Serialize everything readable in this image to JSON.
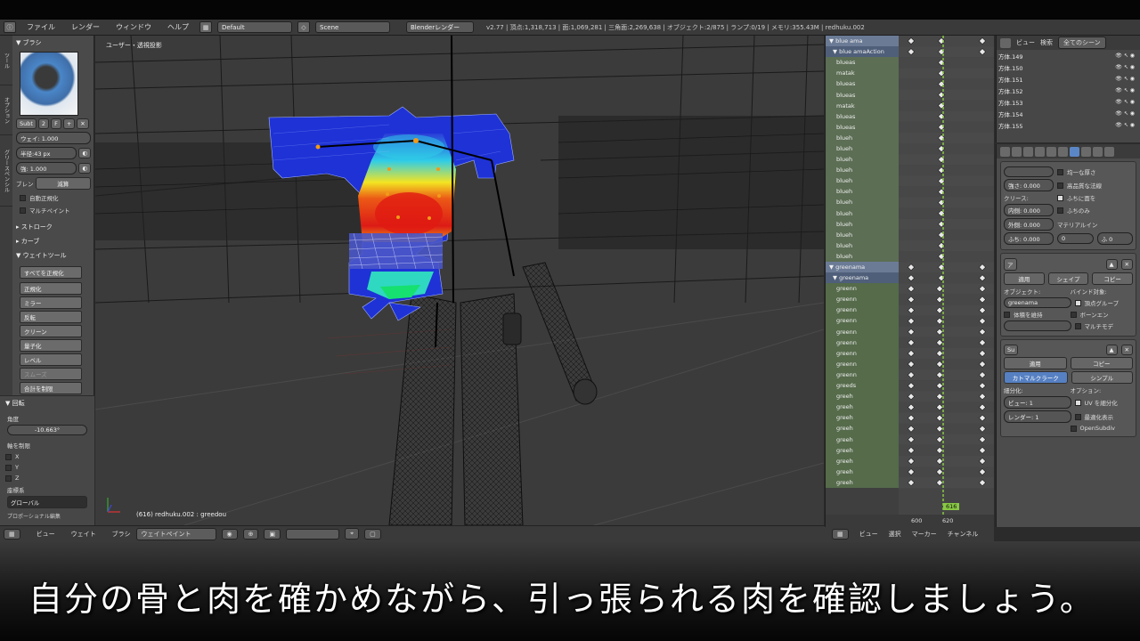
{
  "menubar": {
    "menus": [
      "ファイル",
      "レンダー",
      "ウィンドウ",
      "ヘルプ"
    ],
    "layout": "Default",
    "scene": "Scene",
    "engine": "Blenderレンダー",
    "stats": "v2.77 | 頂点:1,318,713 | 面:1,069,281 | 三角面:2,269,638 | オブジェクト:2/875 | ランプ:0/19 | メモリ:355.43M | redhuku.002"
  },
  "left_panel": {
    "tabs": [
      "ツール",
      "オプション",
      "グリースペンシル"
    ],
    "brush_section": "ブラシ",
    "subtract_label": "Subt",
    "subtract_count": "2",
    "f_label": "F",
    "weight": "ウェイ: 1.000",
    "radius": "半径:43 px",
    "strength": "強: 1.000",
    "blend_label": "ブレン",
    "blend_value": "減算",
    "auto_normalize": "自動正規化",
    "multipaint": "マルチペイント",
    "stroke": "ストローク",
    "curve": "カーブ",
    "weight_tools": "ウェイトツール",
    "tools": [
      "すべてを正規化",
      "正規化",
      "ミラー",
      "反転",
      "クリーン",
      "量子化",
      "レベル",
      "スムーズ",
      "合計を制限"
    ],
    "rotate_section": "回転",
    "angle_label": "角度",
    "angle_value": "-10.663°",
    "constraint_label": "軸を制限",
    "axes": [
      "X",
      "Y",
      "Z"
    ],
    "coord_label": "座標系",
    "coord_value": "グローバル",
    "proportional": "プロポーショナル編集"
  },
  "viewport": {
    "label": "ユーザー・透視投影",
    "footer": "(616) redhuku.002 : greedou"
  },
  "dopesheet": {
    "rows": [
      {
        "t": "obj",
        "n": "blue ama"
      },
      {
        "t": "act",
        "n": "blue amaAction"
      },
      {
        "t": "ch",
        "n": "blueas"
      },
      {
        "t": "ch",
        "n": "matak"
      },
      {
        "t": "ch",
        "n": "blueas"
      },
      {
        "t": "ch",
        "n": "blueas"
      },
      {
        "t": "ch",
        "n": "matak"
      },
      {
        "t": "ch",
        "n": "blueas"
      },
      {
        "t": "ch",
        "n": "blueas"
      },
      {
        "t": "ch",
        "n": "blueh"
      },
      {
        "t": "ch",
        "n": "blueh"
      },
      {
        "t": "ch",
        "n": "blueh"
      },
      {
        "t": "ch",
        "n": "blueh"
      },
      {
        "t": "ch",
        "n": "blueh"
      },
      {
        "t": "ch",
        "n": "blueh"
      },
      {
        "t": "ch",
        "n": "blueh"
      },
      {
        "t": "ch",
        "n": "blueh"
      },
      {
        "t": "ch",
        "n": "blueh"
      },
      {
        "t": "ch",
        "n": "blueh"
      },
      {
        "t": "ch",
        "n": "blueh"
      },
      {
        "t": "ch",
        "n": "blueh"
      },
      {
        "t": "obj",
        "n": "greenama"
      },
      {
        "t": "act",
        "n": "greenama"
      },
      {
        "t": "ch2",
        "n": "greenn"
      },
      {
        "t": "ch2",
        "n": "greenn"
      },
      {
        "t": "ch2",
        "n": "greenn"
      },
      {
        "t": "ch2",
        "n": "greenn"
      },
      {
        "t": "ch2",
        "n": "greenn"
      },
      {
        "t": "ch2",
        "n": "greenn"
      },
      {
        "t": "ch2",
        "n": "greenn"
      },
      {
        "t": "ch2",
        "n": "greenn"
      },
      {
        "t": "ch2",
        "n": "greenn"
      },
      {
        "t": "ch2",
        "n": "greeds"
      },
      {
        "t": "ch2",
        "n": "greeh"
      },
      {
        "t": "ch2",
        "n": "greeh"
      },
      {
        "t": "ch2",
        "n": "greeh"
      },
      {
        "t": "ch2",
        "n": "greeh"
      },
      {
        "t": "ch2",
        "n": "greeh"
      },
      {
        "t": "ch2",
        "n": "greeh"
      },
      {
        "t": "ch2",
        "n": "greeh"
      },
      {
        "t": "ch2",
        "n": "greeh"
      },
      {
        "t": "ch2",
        "n": "greeh"
      }
    ],
    "ruler": [
      "600",
      "620"
    ],
    "current_frame": "616"
  },
  "outliner": {
    "view_label": "ビュー",
    "search_label": "検索",
    "scope": "全てのシーン",
    "items": [
      "方体.149",
      "方体.150",
      "方体.151",
      "方体.152",
      "方体.153",
      "方体.154",
      "方体.155"
    ]
  },
  "properties": {
    "uniform_thickness": "均一な厚さ",
    "high_quality_normals": "高品質な法線",
    "rim_fill": "ふちに面を",
    "rim_only": "ふちのみ",
    "offset": "強さ: 0.000",
    "crease_label": "クリース:",
    "inner": "内側: 0.000",
    "outer": "外側: 0.000",
    "rim": "ふち: 0.000",
    "material_label": "マテリアルイン",
    "material_v1": "0",
    "material_v2": "ふ 0",
    "mod_apply": "適用",
    "mod_shape": "シェイプ",
    "mod_copy": "コピー",
    "object_label": "オブジェクト:",
    "object_value": "greenama",
    "bind_label": "バインド対象:",
    "vertex_groups": "頂点グループ",
    "preserve_volume": "体積を維持",
    "bone_env": "ボーンエン",
    "multi_mod": "マルチモデ",
    "sub_apply": "適用",
    "sub_copy": "コピー",
    "catmull": "カトマルクラーク",
    "simple": "シンプル",
    "subdiv_label": "細分化:",
    "options_label": "オプション:",
    "view_level": "ビュー: 1",
    "render_level": "レンダー: 1",
    "subdiv_uv": "UV を細分化",
    "optimal_display": "最適化表示",
    "opensubdiv": "OpenSubdiv"
  },
  "bottombar": {
    "items": [
      "ビュー",
      "ウェイト",
      "ブラシ"
    ],
    "mode": "ウェイトペイント"
  },
  "dope_bottombar": {
    "items": [
      "ビュー",
      "選択",
      "マーカー",
      "チャンネル"
    ]
  },
  "subtitle": "自分の骨と肉を確かめながら、引っ張られる肉を確認しましょう。"
}
